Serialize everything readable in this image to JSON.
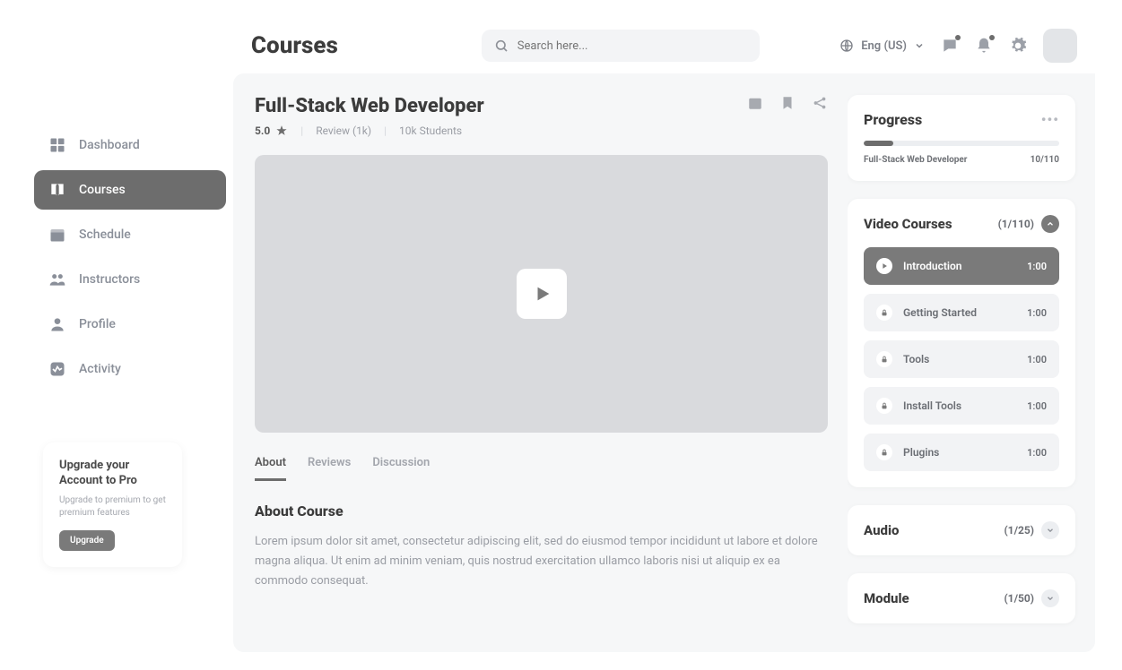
{
  "header": {
    "page_title": "Courses",
    "search_placeholder": "Search here...",
    "language": "Eng (US)"
  },
  "sidebar": {
    "items": [
      {
        "label": "Dashboard"
      },
      {
        "label": "Courses"
      },
      {
        "label": "Schedule"
      },
      {
        "label": "Instructors"
      },
      {
        "label": "Profile"
      },
      {
        "label": "Activity"
      }
    ],
    "upgrade": {
      "title": "Upgrade your Account to Pro",
      "desc": "Upgrade to premium to get premium features",
      "button": "Upgrade"
    }
  },
  "course": {
    "title": "Full-Stack Web Developer",
    "rating": "5.0",
    "reviews": "Review (1k)",
    "students": "10k Students",
    "tabs": {
      "about": "About",
      "reviews": "Reviews",
      "discussion": "Discussion"
    },
    "about_heading": "About Course",
    "about_text": "Lorem ipsum dolor sit amet, consectetur adipiscing elit, sed do eiusmod tempor incididunt ut labore et dolore magna aliqua. Ut enim ad minim veniam, quis nostrud exercitation ullamco laboris nisi ut aliquip ex ea commodo consequat."
  },
  "progress": {
    "title": "Progress",
    "course_name": "Full-Stack Web Developer",
    "count": "10/110"
  },
  "video_courses": {
    "title": "Video Courses",
    "count": "(1/110)",
    "lessons": [
      {
        "title": "Introduction",
        "duration": "1:00"
      },
      {
        "title": "Getting Started",
        "duration": "1:00"
      },
      {
        "title": "Tools",
        "duration": "1:00"
      },
      {
        "title": "Install Tools",
        "duration": "1:00"
      },
      {
        "title": "Plugins",
        "duration": "1:00"
      }
    ]
  },
  "audio": {
    "title": "Audio",
    "count": "(1/25)"
  },
  "module": {
    "title": "Module",
    "count": "(1/50)"
  }
}
